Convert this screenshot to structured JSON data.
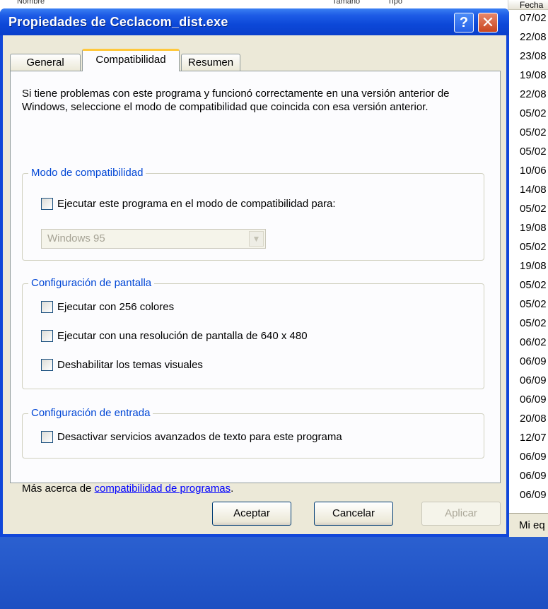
{
  "window": {
    "title": "Propiedades de Ceclacom_dist.exe",
    "help_label": "?",
    "close_label": "✕"
  },
  "tabs": [
    {
      "label": "General",
      "active": false
    },
    {
      "label": "Compatibilidad",
      "active": true
    },
    {
      "label": "Resumen",
      "active": false
    }
  ],
  "intro": "Si tiene problemas con este programa y funcionó correctamente en una versión anterior de Windows, seleccione el modo de compatibilidad que coincida con esa versión anterior.",
  "compat_mode": {
    "title": "Modo de compatibilidad",
    "checkbox_label": "Ejecutar este programa en el modo de compatibilidad para:",
    "checked": false,
    "select_value": "Windows 95",
    "select_disabled": true
  },
  "display": {
    "title": "Configuración de pantalla",
    "options": [
      {
        "label": "Ejecutar con 256 colores",
        "checked": false
      },
      {
        "label": "Ejecutar con una resolución de pantalla de 640 x 480",
        "checked": false
      },
      {
        "label": "Deshabilitar los temas visuales",
        "checked": false
      }
    ]
  },
  "input": {
    "title": "Configuración de entrada",
    "checkbox_label": "Desactivar servicios avanzados de texto para este programa",
    "checked": false
  },
  "more": {
    "prefix": "Más acerca de ",
    "link": "compatibilidad de programas",
    "suffix": "."
  },
  "buttons": {
    "ok": "Aceptar",
    "cancel": "Cancelar",
    "apply": "Aplicar"
  },
  "background": {
    "top_labels": [
      "Nombre",
      "Tamaño",
      "Tipo"
    ],
    "column_header": "Fecha",
    "dates": [
      "07/02",
      "22/08",
      "23/08",
      "19/08",
      "22/08",
      "05/02",
      "05/02",
      "05/02",
      "10/06",
      "14/08",
      "05/02",
      "19/08",
      "05/02",
      "19/08",
      "05/02",
      "05/02",
      "05/02",
      "06/02",
      "06/09",
      "06/09",
      "06/09",
      "20/08",
      "12/07",
      "06/09",
      "06/09",
      "06/09"
    ],
    "status": "Mi eq"
  },
  "colors": {
    "titlebar": "#0c48d8",
    "dialog_face": "#ece9d8",
    "group_title": "#0046d5",
    "link": "#0000ff",
    "desktop": "#1d4fc2"
  }
}
